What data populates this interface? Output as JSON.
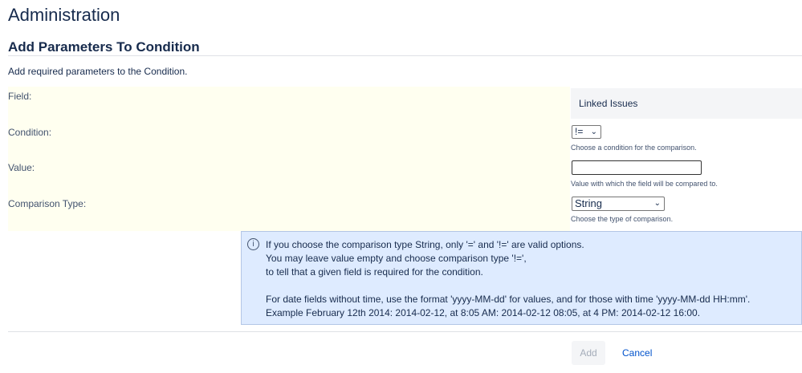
{
  "page_title": "Administration",
  "section_title": "Add Parameters To Condition",
  "description": "Add required parameters to the Condition.",
  "form": {
    "field": {
      "label": "Field:",
      "value": "Linked Issues"
    },
    "condition": {
      "label": "Condition:",
      "value": "!=",
      "help": "Choose a condition for the comparison."
    },
    "value": {
      "label": "Value:",
      "value": "",
      "help": "Value with which the field will be compared to."
    },
    "comparison_type": {
      "label": "Comparison Type:",
      "value": "String",
      "help": "Choose the type of comparison."
    }
  },
  "info": {
    "lines": [
      "If you choose the comparison type String, only '=' and '!=' are valid options.",
      "You may leave value empty and choose comparison type '!=',",
      "to tell that a given field is required for the condition.",
      "For date fields without time, use the format 'yyyy-MM-dd' for values, and for those with time 'yyyy-MM-dd HH:mm'.",
      "Example February 12th 2014: 2014-02-12, at 8:05 AM: 2014-02-12 08:05, at 4 PM: 2014-02-12 16:00."
    ]
  },
  "buttons": {
    "add": "Add",
    "cancel": "Cancel"
  }
}
